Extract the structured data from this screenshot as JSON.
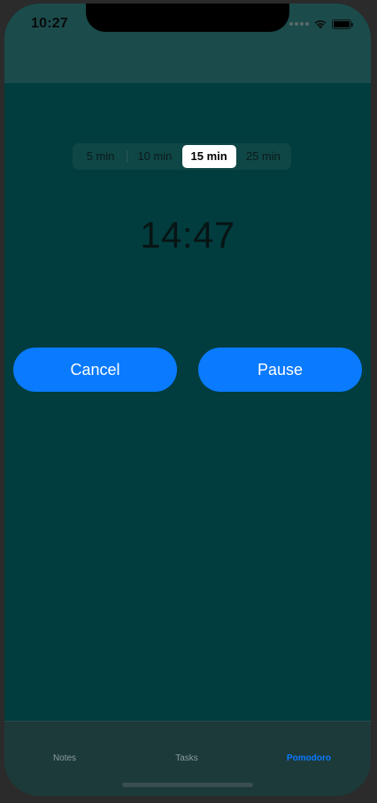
{
  "status_bar": {
    "time": "10:27",
    "wifi_icon": "wifi-icon",
    "battery_icon": "battery-icon"
  },
  "duration_selector": {
    "options": [
      "5 min",
      "10 min",
      "15 min",
      "25 min"
    ],
    "selected": "15 min"
  },
  "timer": {
    "display": "14:47"
  },
  "buttons": {
    "cancel_label": "Cancel",
    "pause_label": "Pause"
  },
  "tabbar": {
    "tabs": [
      {
        "label": "Notes",
        "active": false
      },
      {
        "label": "Tasks",
        "active": false
      },
      {
        "label": "Pomodoro",
        "active": true
      }
    ]
  },
  "colors": {
    "background": "#013d3f",
    "accent": "#0a7aff",
    "tabbar": "#1d3a3a"
  }
}
